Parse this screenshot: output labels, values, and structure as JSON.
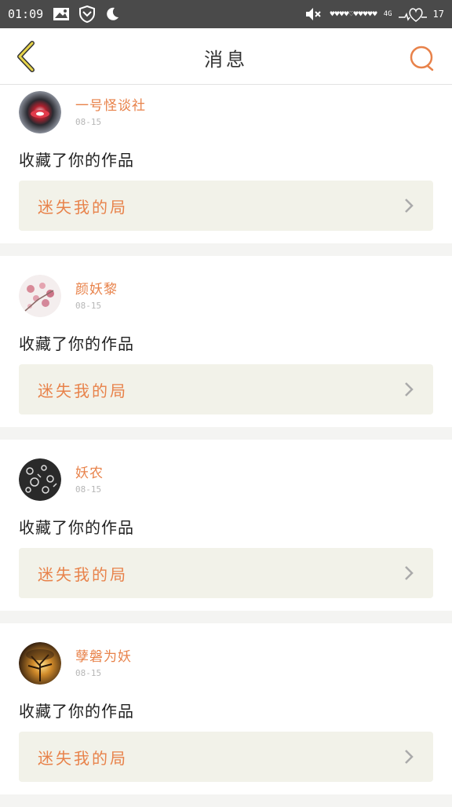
{
  "status_bar": {
    "time": "01:09",
    "network": "4G",
    "signal_text": "♥♥♥♥♡♥♥♥♥♥",
    "battery": "17"
  },
  "header": {
    "title": "消息",
    "back_icon": "chevron-left-icon",
    "search_icon": "search-icon"
  },
  "colors": {
    "accent": "#e8824a",
    "back_arrow": "#d4c23c",
    "card_bg": "#f2f2e9"
  },
  "notifications": [
    {
      "username": "一号怪谈社",
      "date": "08-15",
      "action": "收藏了你的作品",
      "work_title": "迷失我的局",
      "avatar": "swirl-eye"
    },
    {
      "username": "颜妖黎",
      "date": "08-15",
      "action": "收藏了你的作品",
      "work_title": "迷失我的局",
      "avatar": "cherry-blossom"
    },
    {
      "username": "妖农",
      "date": "08-15",
      "action": "收藏了你的作品",
      "work_title": "迷失我的局",
      "avatar": "black-pattern"
    },
    {
      "username": "孽磐为妖",
      "date": "08-15",
      "action": "收藏了你的作品",
      "work_title": "迷失我的局",
      "avatar": "sunset-tree"
    }
  ]
}
